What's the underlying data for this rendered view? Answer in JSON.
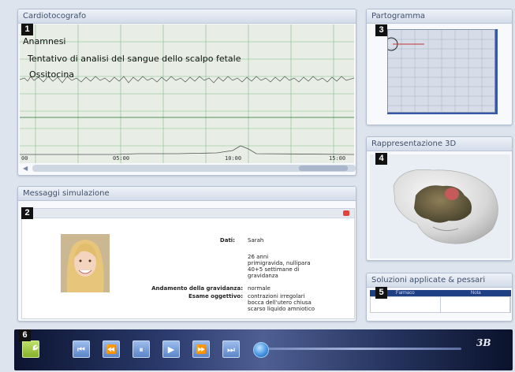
{
  "ctg": {
    "title": "Cardiotocografo",
    "badge": "1",
    "overlay_lines": [
      "Anamnesi",
      "Tentativo di analisi del sangue dello scalpo fetale",
      "Ossitocina"
    ],
    "time_labels": [
      "00",
      "05:00",
      "10:00",
      "15:00"
    ]
  },
  "partogram": {
    "title": "Partogramma",
    "badge": "3"
  },
  "view3d": {
    "title": "Rappresentazione 3D",
    "badge": "4"
  },
  "messages": {
    "title": "Messaggi simulazione",
    "badge": "2",
    "patient": {
      "data_label": "Dati:",
      "data_values": [
        "Sarah",
        "26 anni",
        "primigravida, nullipara",
        "40+5 settimane di",
        "gravidanza"
      ],
      "pregnancy_label": "Andamento della gravidanza:",
      "pregnancy_value": "normale",
      "exam_label": "Esame oggettivo:",
      "exam_values": [
        "contrazioni irregolari",
        "bocca dell'utero chiusa",
        "scarso liquido amniotico"
      ]
    }
  },
  "solutions": {
    "title": "Soluzioni applicate & pessari",
    "badge": "5",
    "columns": [
      "Farmaco",
      "Nota"
    ]
  },
  "toolbar": {
    "badge": "6",
    "logo": "3B",
    "buttons": [
      {
        "name": "skip-start-button",
        "icon": "skip-start-icon",
        "glyph": "⏮"
      },
      {
        "name": "rewind-button",
        "icon": "rewind-icon",
        "glyph": "⏪"
      },
      {
        "name": "pause-button",
        "icon": "pause-icon",
        "glyph": "⏸"
      },
      {
        "name": "play-button",
        "icon": "play-icon",
        "glyph": "▶"
      },
      {
        "name": "fast-forward-button",
        "icon": "fast-forward-icon",
        "glyph": "⏩"
      },
      {
        "name": "skip-end-button",
        "icon": "skip-end-icon",
        "glyph": "⏭"
      }
    ]
  },
  "colors": {
    "ctg_grid": "#3f9b4a",
    "partogram_line": "#c0392b",
    "toolbar_accent": "#5b85c9"
  }
}
